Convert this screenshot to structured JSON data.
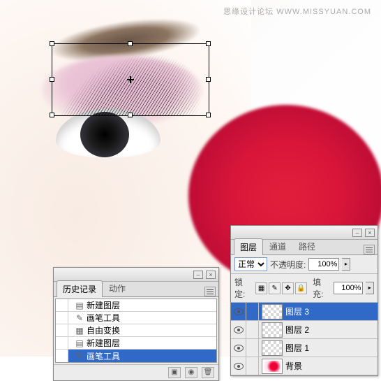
{
  "watermark": "思缘设计论坛  WWW.MISSYUAN.COM",
  "history_panel": {
    "tabs": {
      "history": "历史记录",
      "actions": "动作"
    },
    "items": [
      {
        "icon": "doc-ico",
        "label": "新建图层"
      },
      {
        "icon": "brush-ico",
        "label": "画笔工具"
      },
      {
        "icon": "transform-ico",
        "label": "自由变换"
      },
      {
        "icon": "doc-ico",
        "label": "新建图层"
      },
      {
        "icon": "brush-ico",
        "label": "画笔工具",
        "selected": true,
        "current": true
      }
    ]
  },
  "layers_panel": {
    "tabs": {
      "layers": "图层",
      "channels": "通道",
      "paths": "路径"
    },
    "blend_mode": "正常",
    "opacity_label": "不透明度:",
    "opacity_value": "100%",
    "lock_label": "锁定:",
    "fill_label": "填充:",
    "fill_value": "100%",
    "layers": [
      {
        "name": "图层 3",
        "selected": true,
        "visible": true
      },
      {
        "name": "图层 2",
        "visible": true
      },
      {
        "name": "图层 1",
        "visible": true
      },
      {
        "name": "背景",
        "visible": true,
        "bg": true
      }
    ]
  }
}
